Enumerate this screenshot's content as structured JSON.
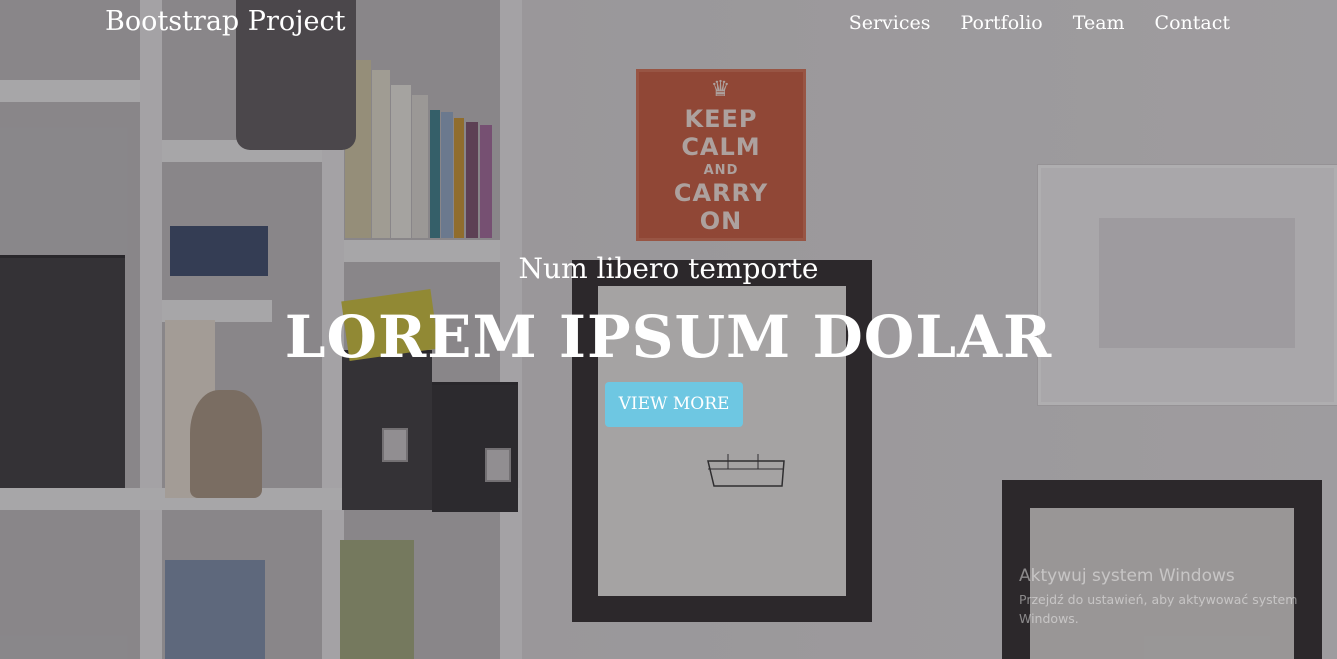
{
  "navbar": {
    "brand": "Bootstrap Project",
    "links": [
      "Services",
      "Portfolio",
      "Team",
      "Contact"
    ]
  },
  "hero": {
    "subtitle": "Num libero temporte",
    "title": "LOREM IPSUM DOLAR",
    "button_label": "VIEW MORE"
  },
  "poster": {
    "lines": [
      "KEEP",
      "CALM",
      "AND",
      "CARRY",
      "ON"
    ]
  },
  "watermark": {
    "title": "Aktywuj system Windows",
    "text": "Przejdź do ustawień, aby aktywować system Windows."
  },
  "colors": {
    "button": "#6ec7e2",
    "poster": "#c85a3c",
    "text": "#ffffff"
  }
}
